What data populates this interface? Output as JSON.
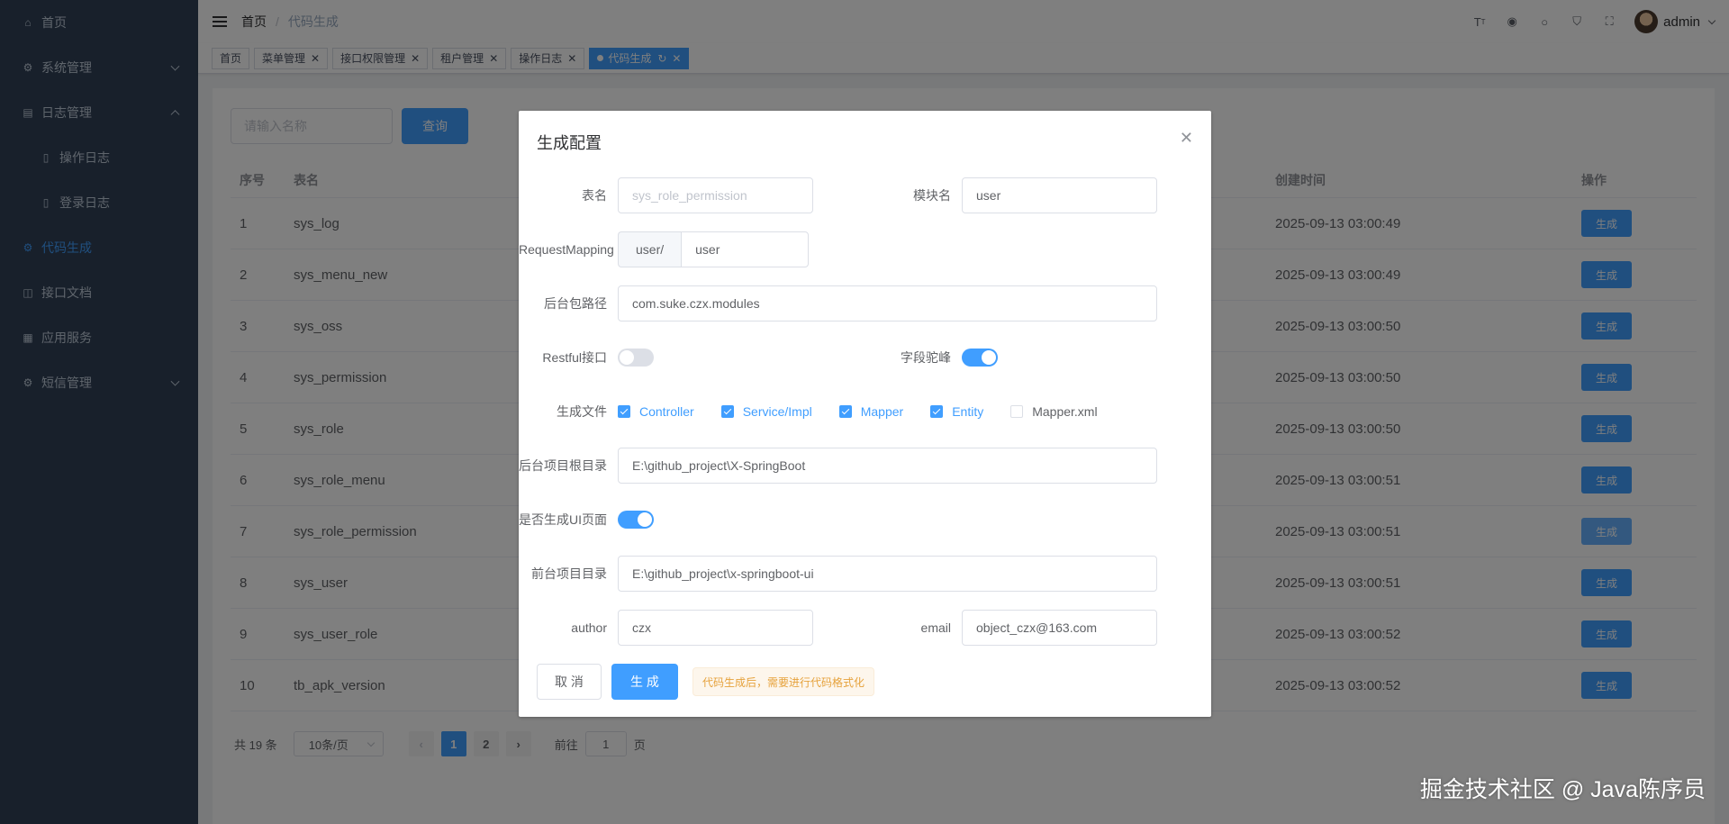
{
  "sidebar": {
    "items": [
      {
        "label": "首页",
        "icon": "home-icon"
      },
      {
        "label": "系统管理",
        "icon": "gear-icon"
      },
      {
        "label": "日志管理",
        "icon": "log-icon"
      },
      {
        "label": "操作日志",
        "icon": "document-icon"
      },
      {
        "label": "登录日志",
        "icon": "document-icon"
      },
      {
        "label": "代码生成",
        "icon": "code-icon"
      },
      {
        "label": "接口文档",
        "icon": "api-doc-icon"
      },
      {
        "label": "应用服务",
        "icon": "apps-icon"
      },
      {
        "label": "短信管理",
        "icon": "sms-icon"
      }
    ]
  },
  "navbar": {
    "breadcrumb": [
      "首页",
      "代码生成"
    ],
    "username": "admin"
  },
  "tags": [
    "首页",
    "菜单管理",
    "接口权限管理",
    "租户管理",
    "操作日志",
    "代码生成"
  ],
  "search": {
    "placeholder": "请输入名称",
    "button": "查询"
  },
  "table": {
    "headers": {
      "no": "序号",
      "name": "表名",
      "time": "创建时间",
      "op": "操作"
    },
    "button_label": "生成",
    "rows": [
      {
        "no": "1",
        "name": "sys_log",
        "time": "2025-09-13 03:00:49"
      },
      {
        "no": "2",
        "name": "sys_menu_new",
        "time": "2025-09-13 03:00:49"
      },
      {
        "no": "3",
        "name": "sys_oss",
        "time": "2025-09-13 03:00:50"
      },
      {
        "no": "4",
        "name": "sys_permission",
        "time": "2025-09-13 03:00:50"
      },
      {
        "no": "5",
        "name": "sys_role",
        "time": "2025-09-13 03:00:50"
      },
      {
        "no": "6",
        "name": "sys_role_menu",
        "time": "2025-09-13 03:00:51"
      },
      {
        "no": "7",
        "name": "sys_role_permission",
        "time": "2025-09-13 03:00:51"
      },
      {
        "no": "8",
        "name": "sys_user",
        "time": "2025-09-13 03:00:51"
      },
      {
        "no": "9",
        "name": "sys_user_role",
        "time": "2025-09-13 03:00:52"
      },
      {
        "no": "10",
        "name": "tb_apk_version",
        "time": "2025-09-13 03:00:52"
      }
    ]
  },
  "pagination": {
    "total": "共 19 条",
    "page_size": "10条/页",
    "pages": [
      "1",
      "2"
    ],
    "goto_label": "前往",
    "goto_value": "1",
    "page_suffix": "页"
  },
  "watermark": "掘金技术社区 @ Java陈序员",
  "dialog": {
    "title": "生成配置",
    "table_name_label": "表名",
    "table_name_placeholder": "sys_role_permission",
    "module_label": "模块名",
    "module_value": "user",
    "mapping_label": "RequestMapping",
    "mapping_prefix": "user/",
    "mapping_value": "user",
    "package_label": "后台包路径",
    "package_value": "com.suke.czx.modules",
    "restful_label": "Restful接口",
    "restful_on": false,
    "camel_label": "字段驼峰",
    "camel_on": true,
    "files_label": "生成文件",
    "files": [
      {
        "label": "Controller",
        "checked": true
      },
      {
        "label": "Service/Impl",
        "checked": true
      },
      {
        "label": "Mapper",
        "checked": true
      },
      {
        "label": "Entity",
        "checked": true
      },
      {
        "label": "Mapper.xml",
        "checked": false
      }
    ],
    "backend_dir_label": "后台项目根目录",
    "backend_dir_value": "E:\\github_project\\X-SpringBoot",
    "ui_label": "是否生成UI页面",
    "ui_on": true,
    "frontend_dir_label": "前台项目目录",
    "frontend_dir_value": "E:\\github_project\\x-springboot-ui",
    "author_label": "author",
    "author_value": "czx",
    "email_label": "email",
    "email_value": "object_czx@163.com",
    "cancel": "取 消",
    "generate": "生 成",
    "tip": "代码生成后，需要进行代码格式化"
  }
}
